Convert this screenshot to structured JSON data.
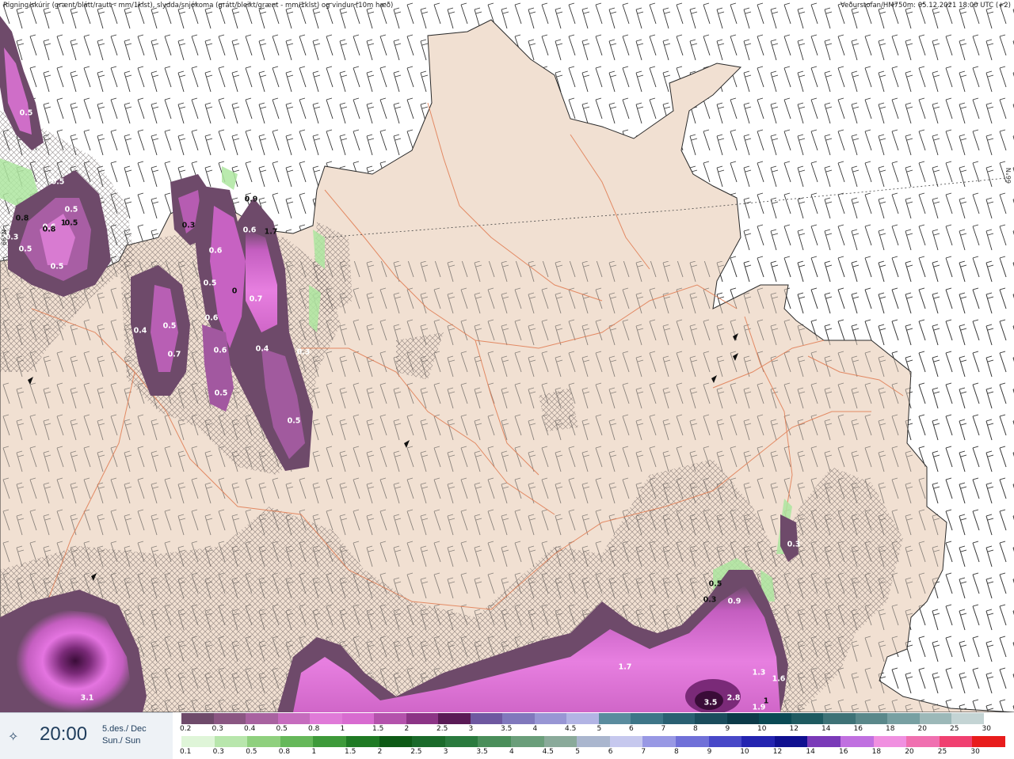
{
  "header": {
    "left": "Rigning/skúrir (grænt/blátt/rautt - mm/1klst), slydda/snjókoma (grátt/bleikt/grænt - mm/1klst) og vindur (10m hæð)",
    "right": "Veðurstofan/HM750m: 05.12.2021 18:00 UTC (+2)"
  },
  "latitude_labels": [
    "66°N",
    "66°N"
  ],
  "map_values": [
    "0.5",
    "0.5",
    "0.8",
    "0.5",
    "0.5",
    "0.6",
    "0.5",
    "0.5",
    "0.8",
    "1",
    "0.3",
    "0.9",
    "0.6",
    "0.6",
    "0.7",
    "1.7",
    "0.5",
    "0",
    "0.4",
    "0.5",
    "0.7",
    "0.6",
    "0.6",
    "0.4",
    "0.3",
    "0.5",
    "0.5",
    "0.3",
    "0.9",
    "0.5",
    "0.3",
    "1.3",
    "1.6",
    "1.7",
    "2.8",
    "3.5",
    "3.1",
    "1.9",
    "1",
    "0.3"
  ],
  "timebox": {
    "time": "20:00",
    "date_line1": "5.des./ Dec",
    "date_line2": "Sun./ Sun"
  },
  "legend": {
    "snow_labels": [
      "0.2",
      "0.3",
      "0.4",
      "0.5",
      "0.8",
      "1",
      "1.5",
      "2",
      "2.5",
      "3",
      "3.5",
      "4",
      "4.5",
      "5",
      "6",
      "7",
      "8",
      "9",
      "10",
      "12",
      "14",
      "16",
      "18",
      "20",
      "25",
      "30"
    ],
    "snow_colors": [
      "#6e4a6a",
      "#8a5682",
      "#a862a0",
      "#c66cbe",
      "#e07ad8",
      "#d86bd0",
      "#b452ac",
      "#8c3486",
      "#5a1a56",
      "#6e58a0",
      "#8078bc",
      "#9896d4",
      "#b2b4e4",
      "#5a8c9e",
      "#3e7688",
      "#2a6072",
      "#1a4c5c",
      "#0c3a48",
      "#0a4a54",
      "#1e5a60",
      "#3e7276",
      "#5a888a",
      "#78a0a2",
      "#9cb8b8",
      "#c4d4d4",
      "#ffffff"
    ],
    "rain_labels": [
      "0.1",
      "0.3",
      "0.5",
      "0.8",
      "1",
      "1.5",
      "2",
      "2.5",
      "3",
      "3.5",
      "4",
      "4.5",
      "5",
      "6",
      "7",
      "8",
      "9",
      "10",
      "12",
      "14",
      "16",
      "18",
      "20",
      "25",
      "30"
    ],
    "rain_colors": [
      "#dff5d8",
      "#b8e6ac",
      "#8fd07e",
      "#66b85a",
      "#3e9a3a",
      "#1f7a24",
      "#0e5a16",
      "#1a6a2a",
      "#2a7a3e",
      "#4a8e5a",
      "#6a9e7a",
      "#8aaa9a",
      "#aab6ce",
      "#c6c8ee",
      "#9898e4",
      "#7070d8",
      "#4848c8",
      "#2424b0",
      "#101090",
      "#7a3ab8",
      "#c070e0",
      "#f090e0",
      "#f070b0",
      "#f04070",
      "#e81c1c"
    ]
  }
}
